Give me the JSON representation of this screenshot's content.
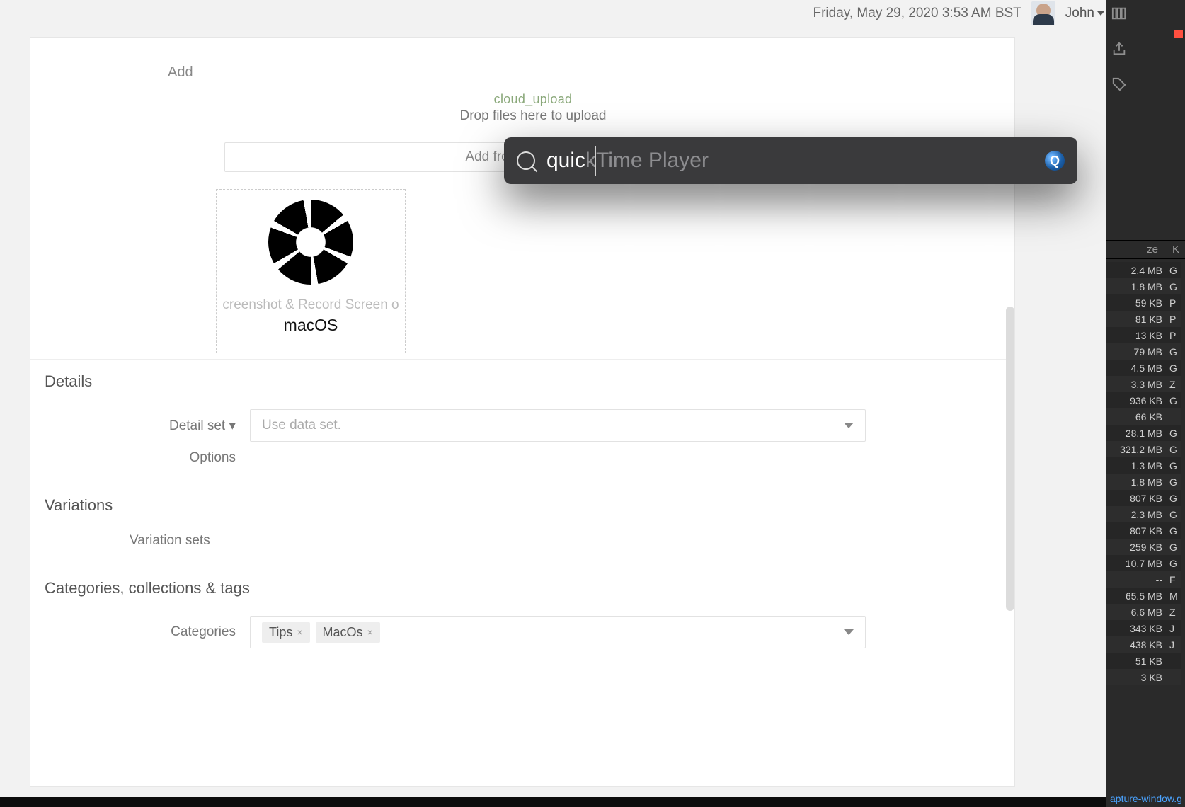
{
  "header": {
    "datetime": "Friday, May 29, 2020 3:53 AM BST",
    "user_name": "John"
  },
  "add_section": {
    "label": "Add",
    "upload_icon_text": "cloud_upload",
    "upload_message": "Drop files here to upload",
    "media_library_button": "Add from media library",
    "thumbnail": {
      "caption_line1": "creenshot & Record Screen o",
      "caption_line2": "macOS"
    }
  },
  "details_section": {
    "title": "Details",
    "detail_set_label": "Detail set",
    "detail_set_placeholder": "Use data set.",
    "options_label": "Options"
  },
  "variations_section": {
    "title": "Variations",
    "variation_sets_label": "Variation sets"
  },
  "taxonomy_section": {
    "title": "Categories, collections & tags",
    "categories_label": "Categories",
    "tags": [
      "Tips",
      "MacOs"
    ]
  },
  "spotlight": {
    "typed": "quic",
    "suggestion_tail": "kTime Player",
    "result_app": "QuickTime Player"
  },
  "finder": {
    "columns": {
      "size": "ze",
      "kind": "K"
    },
    "rows": [
      {
        "size": "2.4 MB",
        "kind": "G"
      },
      {
        "size": "1.8 MB",
        "kind": "G"
      },
      {
        "size": "59 KB",
        "kind": "P"
      },
      {
        "size": "81 KB",
        "kind": "P"
      },
      {
        "size": "13 KB",
        "kind": "P"
      },
      {
        "size": "79 MB",
        "kind": "G"
      },
      {
        "size": "4.5 MB",
        "kind": "G"
      },
      {
        "size": "3.3 MB",
        "kind": "Z"
      },
      {
        "size": "936 KB",
        "kind": "G"
      },
      {
        "size": "66 KB",
        "kind": ""
      },
      {
        "size": "28.1 MB",
        "kind": "G"
      },
      {
        "size": "321.2 MB",
        "kind": "G"
      },
      {
        "size": "1.3 MB",
        "kind": "G"
      },
      {
        "size": "1.8 MB",
        "kind": "G"
      },
      {
        "size": "807 KB",
        "kind": "G"
      },
      {
        "size": "2.3 MB",
        "kind": "G"
      },
      {
        "size": "807 KB",
        "kind": "G"
      },
      {
        "size": "259 KB",
        "kind": "G"
      },
      {
        "size": "10.7 MB",
        "kind": "G"
      },
      {
        "size": "--",
        "kind": "F"
      },
      {
        "size": "65.5 MB",
        "kind": "M"
      },
      {
        "size": "6.6 MB",
        "kind": "Z"
      },
      {
        "size": "343 KB",
        "kind": "J"
      },
      {
        "size": "438 KB",
        "kind": "J"
      },
      {
        "size": "51 KB",
        "kind": ""
      },
      {
        "size": "3 KB",
        "kind": ""
      }
    ],
    "bottom_filename": "apture-window.gif"
  }
}
